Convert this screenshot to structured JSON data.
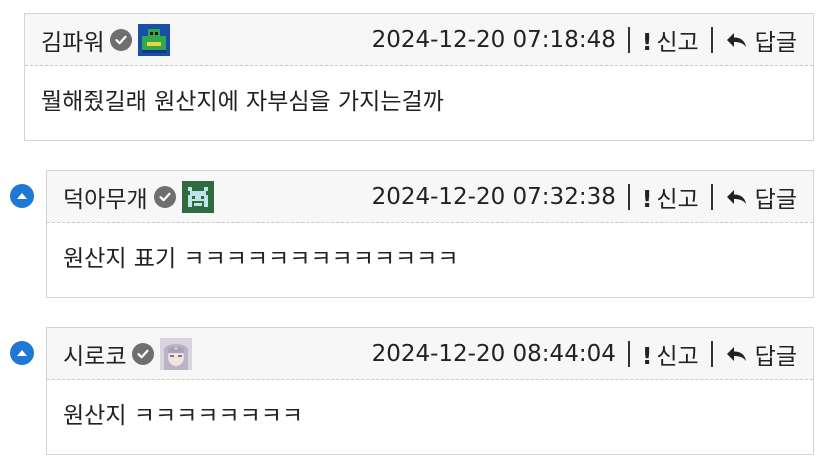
{
  "comments": [
    {
      "author": "김파워",
      "timestamp": "2024-12-20 07:18:48",
      "report_label": "신고",
      "reply_label": "답글",
      "body": "뭘해줬길래 원산지에 자부심을 가지는걸까",
      "avatar_icon": "green-robot-avatar",
      "is_reply": false
    },
    {
      "author": "덕아무개",
      "timestamp": "2024-12-20 07:32:38",
      "report_label": "신고",
      "reply_label": "답글",
      "body": "원산지 표기 ㅋㅋㅋㅋㅋㅋㅋㅋㅋㅋㅋㅋㅋ",
      "avatar_icon": "pixel-creature-avatar",
      "is_reply": true
    },
    {
      "author": "시로코",
      "timestamp": "2024-12-20 08:44:04",
      "report_label": "신고",
      "reply_label": "답글",
      "body": "원산지 ㅋㅋㅋㅋㅋㅋㅋㅋ",
      "avatar_icon": "anime-girl-avatar",
      "is_reply": true
    }
  ],
  "icons": {
    "verified": "check-circle-icon",
    "report": "exclamation-icon",
    "reply": "reply-arrow-icon",
    "collapse": "chevron-up-icon"
  },
  "colors": {
    "accent_blue": "#1e78d4",
    "header_bg": "#f7f7f7",
    "border": "#d4d4d4",
    "verified_gray": "#6f6f6f"
  }
}
